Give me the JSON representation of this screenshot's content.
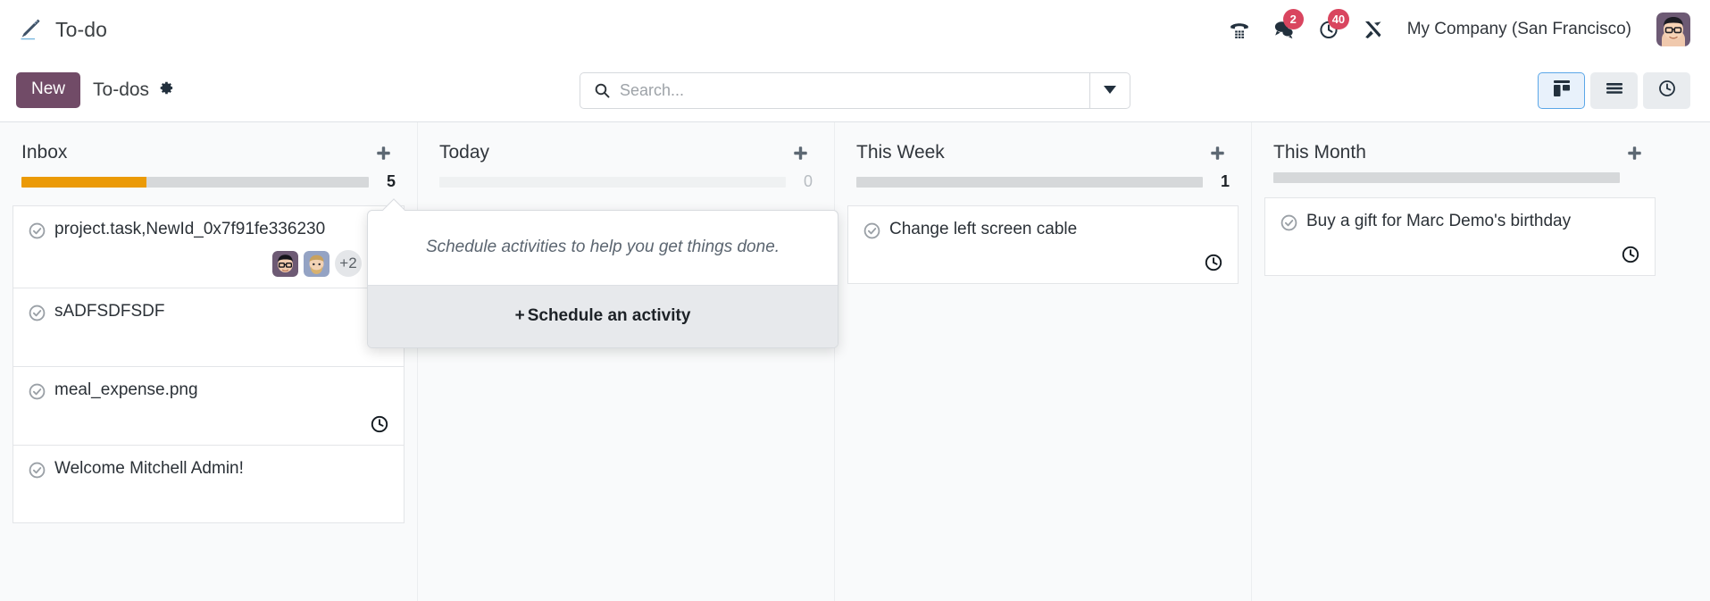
{
  "navbar": {
    "app_title": "To-do",
    "brand_icon": "pencil-icon",
    "icons": [
      {
        "name": "phone-dialpad-icon",
        "badge": null
      },
      {
        "name": "messages-icon",
        "badge": "2"
      },
      {
        "name": "activities-clock-icon",
        "badge": "40"
      },
      {
        "name": "tools-icon",
        "badge": null
      }
    ],
    "company": "My Company (San Francisco)",
    "avatar": "user-avatar"
  },
  "control_panel": {
    "new_label": "New",
    "breadcrumb": "To-dos",
    "gear_icon": "gear-icon",
    "search": {
      "placeholder": "Search...",
      "value": "",
      "icon": "search-icon",
      "toggle_icon": "chevron-down-icon"
    },
    "views": [
      {
        "name": "kanban-view-button",
        "icon": "kanban-icon",
        "active": true
      },
      {
        "name": "list-view-button",
        "icon": "list-icon",
        "active": false
      },
      {
        "name": "activity-view-button",
        "icon": "clock-icon",
        "active": false
      }
    ]
  },
  "kanban": {
    "add_icon": "plus-icon",
    "columns": [
      {
        "title": "Inbox",
        "count": "5",
        "count_is_zero": false,
        "progress": [
          {
            "color": "#eb9a06",
            "width": "36%"
          },
          {
            "color": "#d6d8da",
            "width": "64%"
          }
        ],
        "cards": [
          {
            "title": "project.task,NewId_0x7f91fe336230",
            "check_icon": "check-circle-icon",
            "menu_icon": "vertical-dots-icon",
            "has_menu": true,
            "avatars": [
              "assignee-avatar-1",
              "assignee-avatar-2"
            ],
            "more_avatars": "+2",
            "clock_icon": "clock-icon"
          },
          {
            "title": "sADFSDFSDF",
            "check_icon": "check-circle-icon",
            "has_menu": false,
            "avatars": [],
            "more_avatars": null,
            "clock_icon": null
          },
          {
            "title": "meal_expense.png",
            "check_icon": "check-circle-icon",
            "has_menu": false,
            "avatars": [],
            "more_avatars": null,
            "clock_icon": "clock-icon"
          },
          {
            "title": "Welcome Mitchell Admin!",
            "check_icon": "check-circle-icon",
            "has_menu": false,
            "avatars": [],
            "more_avatars": null,
            "clock_icon": null
          }
        ]
      },
      {
        "title": "Today",
        "count": "0",
        "count_is_zero": true,
        "progress": [
          {
            "color": "#eff1f2",
            "width": "100%"
          }
        ],
        "cards": []
      },
      {
        "title": "This Week",
        "count": "1",
        "count_is_zero": false,
        "progress": [
          {
            "color": "#d6d8da",
            "width": "100%"
          }
        ],
        "cards": [
          {
            "title": "Change left screen cable",
            "check_icon": "check-circle-icon",
            "has_menu": false,
            "avatars": [],
            "more_avatars": null,
            "clock_icon": "clock-icon"
          }
        ]
      },
      {
        "title": "This Month",
        "count": "",
        "count_is_zero": true,
        "progress": [
          {
            "color": "#d6d8da",
            "width": "100%"
          }
        ],
        "cards": [
          {
            "title": "Buy a gift for Marc Demo's birthday",
            "check_icon": "check-circle-icon",
            "has_menu": false,
            "avatars": [],
            "more_avatars": null,
            "clock_icon": "clock-icon"
          }
        ]
      }
    ]
  },
  "popover": {
    "message": "Schedule activities to help you get things done.",
    "action_plus": "+",
    "action_label": "Schedule an activity"
  },
  "colors": {
    "accent_purple": "#714b67",
    "badge_red": "#d9455f",
    "progress_orange": "#eb9a06",
    "active_view_border": "#5ba7e8"
  }
}
